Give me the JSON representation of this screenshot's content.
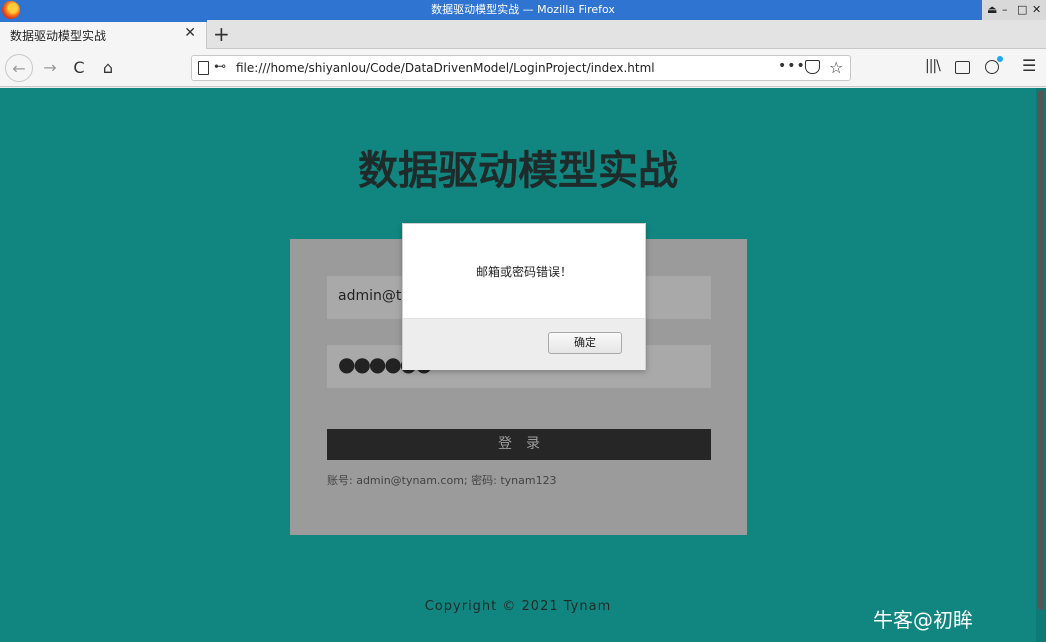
{
  "window": {
    "title": "数据驱动模型实战 — Mozilla Firefox",
    "controls": [
      "⏏",
      "–",
      "□",
      "✕"
    ]
  },
  "tabs": [
    {
      "label": "数据驱动模型实战",
      "close": "✕"
    }
  ],
  "new_tab_label": "+",
  "nav": {
    "back": "←",
    "forward": "→",
    "reload": "C",
    "home": "⌂",
    "url": "file:///home/shiyanlou/Code/DataDrivenModel/LoginProject/index.html",
    "more": "•••",
    "star": "☆",
    "library": "|||\\",
    "menu": "☰"
  },
  "page": {
    "heading": "数据驱动模型实战",
    "email_value": "admin@ty",
    "password_mask": "●●●●●●",
    "login_button": "登录",
    "hint": "账号: admin@tynam.com; 密码: tynam123",
    "copyright": "Copyright © 2021 Tynam"
  },
  "dialog": {
    "message": "邮箱或密码错误！",
    "ok_label": "确定"
  },
  "watermark": "牛客@初眸",
  "colors": {
    "page_background": "#118680",
    "login_box": "#9b9b9b",
    "login_button": "#262626",
    "titlebar": "#2f74d0"
  }
}
